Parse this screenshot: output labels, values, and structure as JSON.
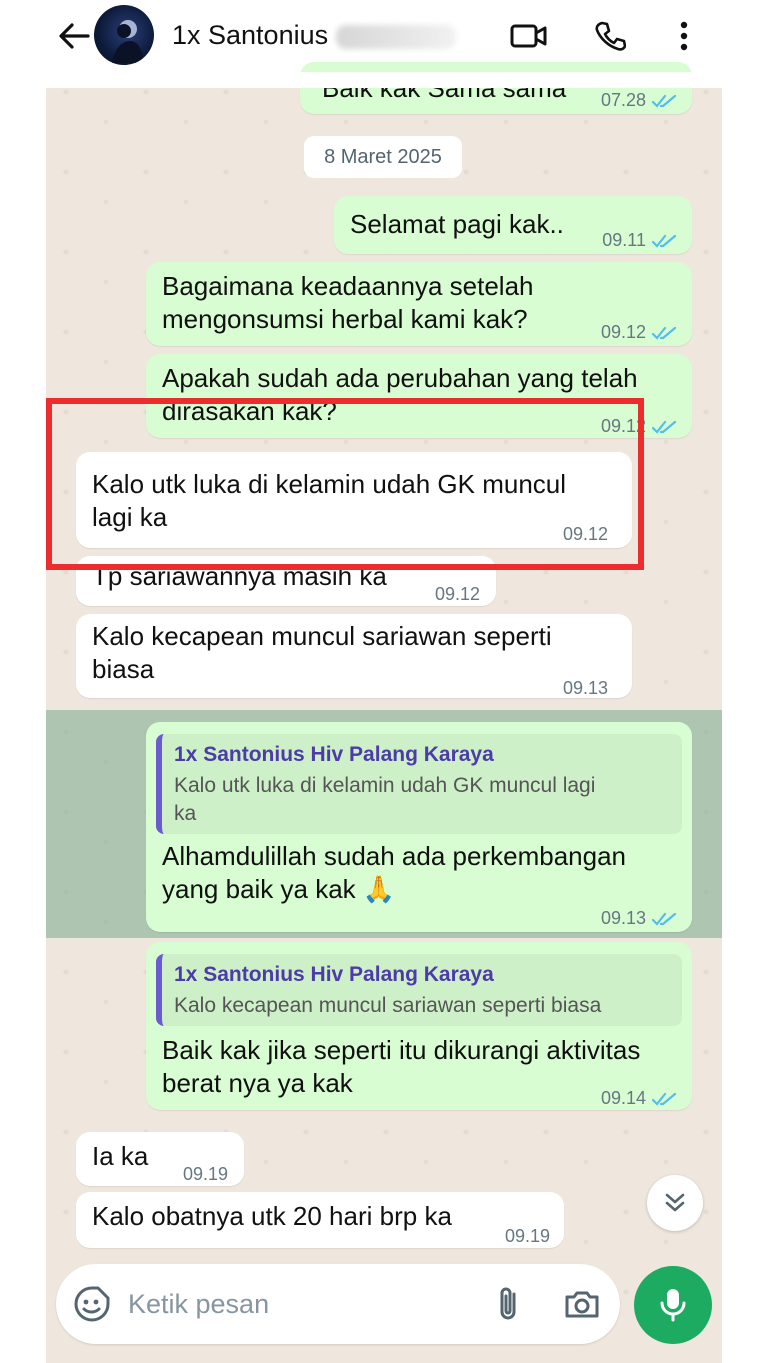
{
  "header": {
    "contact_name": "1x Santonius",
    "icons": [
      "back-arrow-icon",
      "video-call-icon",
      "phone-icon",
      "more-vert-icon"
    ]
  },
  "chat": {
    "date_separator": "8 Maret 2025",
    "messages": [
      {
        "dir": "out",
        "text": "Baik kak Sama sama",
        "time": "07.28",
        "read": true
      },
      {
        "dir": "out",
        "text": "Selamat pagi kak..",
        "time": "09.11",
        "read": true
      },
      {
        "dir": "out",
        "text": "Bagaimana keadaannya setelah\nmengonsumsi herbal kami kak?",
        "time": "09.12",
        "read": true
      },
      {
        "dir": "out",
        "text": "Apakah sudah ada perubahan yang telah\ndirasakan kak?",
        "time": "09.12",
        "read": true
      },
      {
        "dir": "in",
        "text": "Kalo utk luka di kelamin udah GK muncul\nlagi ka",
        "time": "09.12"
      },
      {
        "dir": "in",
        "text": "Tp sariawannya masih ka",
        "time": "09.12"
      },
      {
        "dir": "in",
        "text": "Kalo kecapean muncul sariawan seperti\nbiasa",
        "time": "09.13"
      },
      {
        "dir": "out",
        "quote_author": "1x Santonius Hiv Palang Karaya",
        "quote_text": "Kalo utk luka di kelamin udah GK muncul lagi\nka",
        "text": "Alhamdulillah sudah ada perkembangan\nyang baik ya kak 🙏",
        "time": "09.13",
        "read": true
      },
      {
        "dir": "out",
        "quote_author": "1x Santonius Hiv Palang Karaya",
        "quote_text": "Kalo kecapean muncul sariawan seperti biasa",
        "text": "Baik kak jika seperti itu dikurangi aktivitas\nberat nya ya kak",
        "time": "09.14",
        "read": true
      },
      {
        "dir": "in",
        "text": "Ia ka",
        "time": "09.19"
      },
      {
        "dir": "in",
        "text": "Kalo obatnya utk 20 hari brp ka",
        "time": "09.19"
      }
    ]
  },
  "composer": {
    "placeholder": "Ketik pesan"
  },
  "colors": {
    "outgoing_bubble": "#d9fdd3",
    "incoming_bubble": "#ffffff",
    "chat_background": "#efe7dd",
    "highlight_box": "#ec2d2d",
    "mic_button": "#1daa61",
    "read_ticks": "#53bdeb"
  }
}
